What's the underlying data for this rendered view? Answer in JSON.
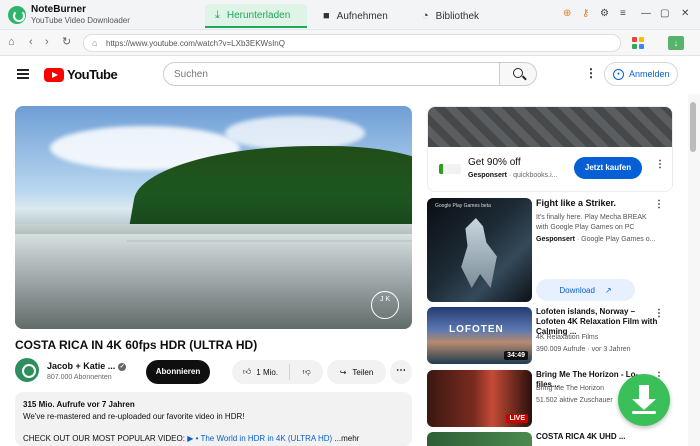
{
  "app": {
    "name": "NoteBurner",
    "subtitle": "YouTube Video Downloader"
  },
  "tabs": [
    {
      "label": "Herunterladen",
      "icon": "download-icon",
      "active": true
    },
    {
      "label": "Aufnehmen",
      "icon": "video-camera-icon",
      "active": false
    },
    {
      "label": "Bibliothek",
      "icon": "clock-icon",
      "active": false
    }
  ],
  "browser": {
    "url": "https://www.youtube.com/watch?v=LXb3EKWsInQ"
  },
  "youtube": {
    "logo_text": "YouTube",
    "search_placeholder": "Suchen",
    "signin_label": "Anmelden"
  },
  "video": {
    "title": "COSTA RICA IN 4K 60fps HDR (ULTRA HD)",
    "channel_name": "Jacob + Katie ...",
    "subscribers": "807.000 Abonnenten",
    "subscribe_label": "Abonnieren",
    "likes": "1 Mio.",
    "share_label": "Teilen",
    "watermark_text": "J K",
    "description": {
      "meta": "315 Mio. Aufrufe  vor 7 Jahren",
      "line1": "We've re-mastered and re-uploaded our favorite video in HDR!",
      "line2_prefix": "CHECK OUT OUR MOST POPULAR VIDEO: ",
      "line2_link": "▶ • The World in HDR in 4K (ULTRA HD)",
      "line2_more": "  ...mehr"
    }
  },
  "ad": {
    "title": "Get 90% off",
    "sponsor_label": "Gesponsert",
    "sponsor_domain": "· quickbooks.i...",
    "button_label": "Jetzt kaufen"
  },
  "sidebar_videos": [
    {
      "title": "Fight like a Striker.",
      "line1": "It's finally here. Play Mecha BREAK",
      "line2": "with Google Play Games on PC",
      "line3_bold": "Gesponsert",
      "line3_rest": " · Google Play Games o...",
      "button_label": "Download",
      "thumb_label": "Google Play Games beta"
    },
    {
      "title": "Lofoten islands, Norway – Lofoten 4K Relaxation Film with Calming ...",
      "channel": "4K Relaxation Films",
      "stats": "390.009 Aufrufe · vor 3 Jahren",
      "duration": "34:49",
      "thumb_label": "LOFOTEN"
    },
    {
      "title": "Bring Me The Horizon - Lo-files...",
      "channel": "Bring Me The Horizon",
      "stats": "51.502 aktive Zuschauer",
      "badge": "LIVE"
    },
    {
      "title": "COSTA RICA 4K UHD ..."
    }
  ]
}
